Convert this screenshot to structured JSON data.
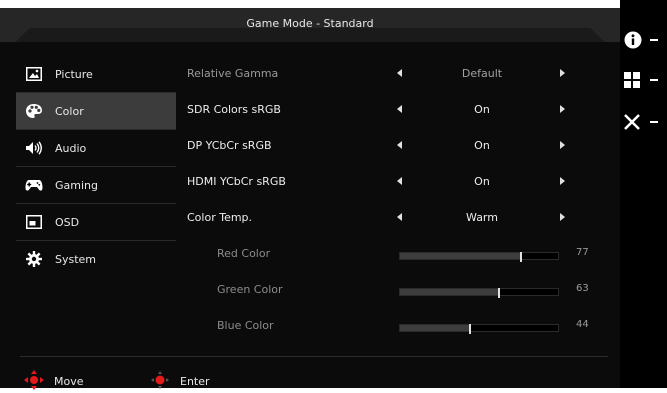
{
  "header_fragment": "",
  "title": "Game Mode - Standard",
  "sidebar": {
    "items": [
      {
        "label": "Picture",
        "icon": "picture-icon",
        "selected": false
      },
      {
        "label": "Color",
        "icon": "palette-icon",
        "selected": true
      },
      {
        "label": "Audio",
        "icon": "speaker-icon",
        "selected": false
      },
      {
        "label": "Gaming",
        "icon": "gamepad-icon",
        "selected": false
      },
      {
        "label": "OSD",
        "icon": "osd-window-icon",
        "selected": false
      },
      {
        "label": "System",
        "icon": "gear-icon",
        "selected": false
      }
    ]
  },
  "settings": {
    "relative_gamma": {
      "label": "Relative Gamma",
      "value": "Default"
    },
    "sdr_colors": {
      "label": "SDR Colors sRGB",
      "value": "On"
    },
    "dp_ycbcr": {
      "label": "DP YCbCr sRGB",
      "value": "On"
    },
    "hdmi_ycbcr": {
      "label": "HDMI YCbCr sRGB",
      "value": "On"
    },
    "color_temp": {
      "label": "Color Temp.",
      "value": "Warm"
    },
    "red": {
      "label": "Red Color",
      "value": "77",
      "level": 0.77
    },
    "green": {
      "label": "Green Color",
      "value": "63",
      "level": 0.63
    },
    "blue": {
      "label": "Blue Color",
      "value": "44",
      "level": 0.44
    }
  },
  "footer": {
    "move_label": "Move",
    "enter_label": "Enter"
  },
  "right_panel": {
    "items": [
      {
        "icon": "info-icon"
      },
      {
        "icon": "menu-grid-icon"
      },
      {
        "icon": "close-icon"
      }
    ]
  },
  "colors": {
    "background": "#0b0b0b",
    "selected_item": "#3c3c3c",
    "bar_fill": "#3d3d3d",
    "accent_red": "#e11a1a"
  }
}
